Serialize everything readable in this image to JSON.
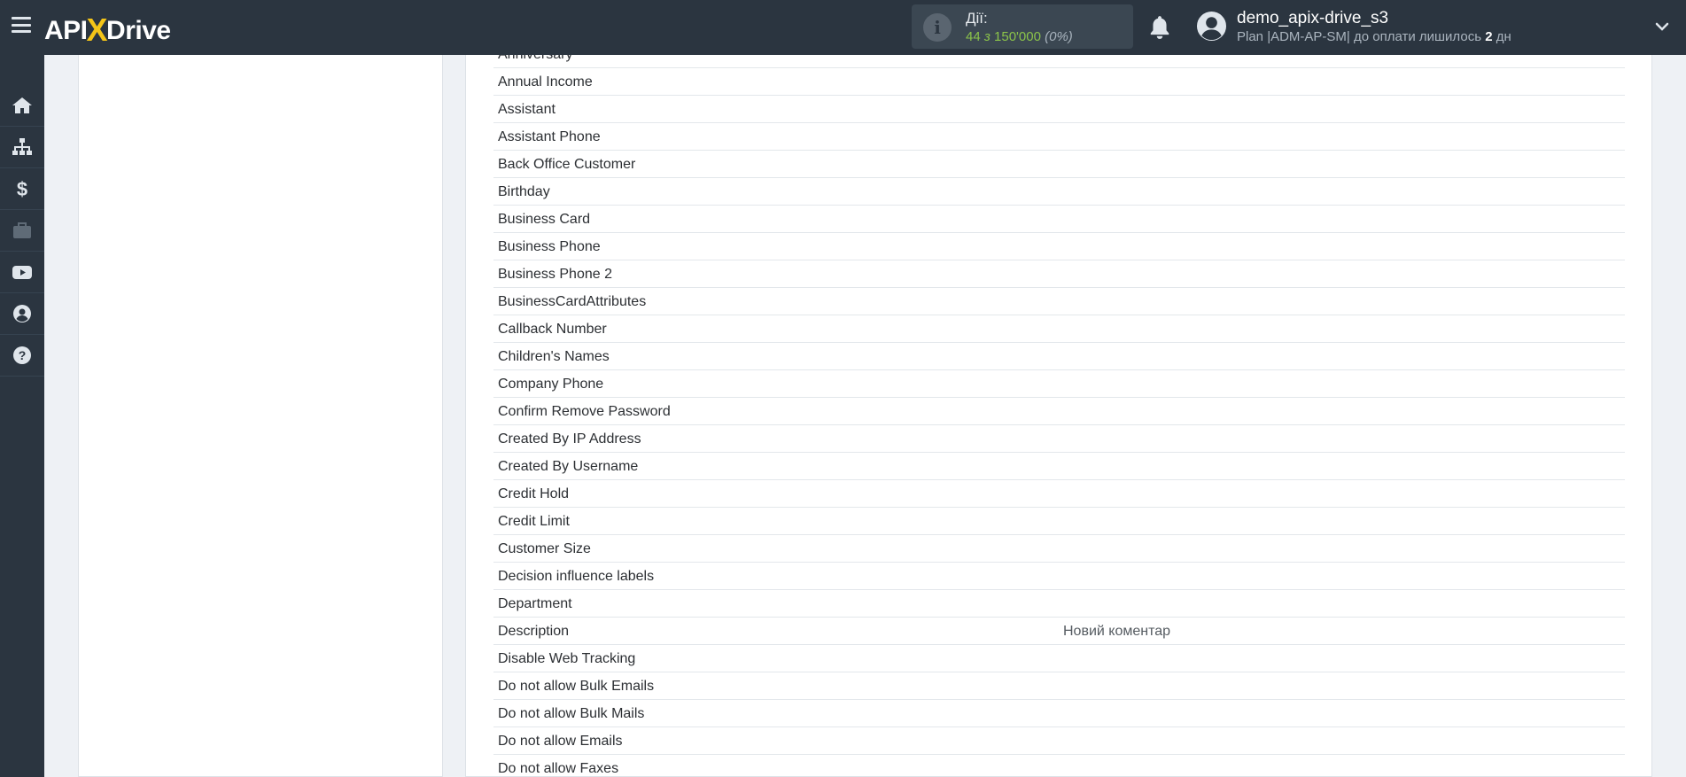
{
  "header": {
    "logo": {
      "prefix": "API",
      "x": "X",
      "suffix": "Drive"
    },
    "actions": {
      "label": "Дії:",
      "used": "44",
      "of": "з",
      "total": "150'000",
      "percent": "(0%)"
    },
    "user": {
      "name": "demo_apix-drive_s3",
      "plan_prefix": "Plan |ADM-AP-SM| до оплати лишилось",
      "days": "2",
      "days_unit": "дн"
    }
  },
  "sidebar": {
    "items": [
      {
        "icon": "home-icon"
      },
      {
        "icon": "sitemap-icon"
      },
      {
        "icon": "dollar-icon"
      },
      {
        "icon": "briefcase-icon"
      },
      {
        "icon": "youtube-icon"
      },
      {
        "icon": "user-circle-icon"
      },
      {
        "icon": "help-icon"
      }
    ]
  },
  "fields": [
    {
      "name": "Anniversary",
      "value": ""
    },
    {
      "name": "Annual Income",
      "value": ""
    },
    {
      "name": "Assistant",
      "value": ""
    },
    {
      "name": "Assistant Phone",
      "value": ""
    },
    {
      "name": "Back Office Customer",
      "value": ""
    },
    {
      "name": "Birthday",
      "value": ""
    },
    {
      "name": "Business Card",
      "value": ""
    },
    {
      "name": "Business Phone",
      "value": ""
    },
    {
      "name": "Business Phone 2",
      "value": ""
    },
    {
      "name": "BusinessCardAttributes",
      "value": ""
    },
    {
      "name": "Callback Number",
      "value": ""
    },
    {
      "name": "Children's Names",
      "value": ""
    },
    {
      "name": "Company Phone",
      "value": ""
    },
    {
      "name": "Confirm Remove Password",
      "value": ""
    },
    {
      "name": "Created By IP Address",
      "value": ""
    },
    {
      "name": "Created By Username",
      "value": ""
    },
    {
      "name": "Credit Hold",
      "value": ""
    },
    {
      "name": "Credit Limit",
      "value": ""
    },
    {
      "name": "Customer Size",
      "value": ""
    },
    {
      "name": "Decision influence labels",
      "value": ""
    },
    {
      "name": "Department",
      "value": ""
    },
    {
      "name": "Description",
      "value": "Новий коментар"
    },
    {
      "name": "Disable Web Tracking",
      "value": ""
    },
    {
      "name": "Do not allow Bulk Emails",
      "value": ""
    },
    {
      "name": "Do not allow Bulk Mails",
      "value": ""
    },
    {
      "name": "Do not allow Emails",
      "value": ""
    },
    {
      "name": "Do not allow Faxes",
      "value": ""
    }
  ]
}
